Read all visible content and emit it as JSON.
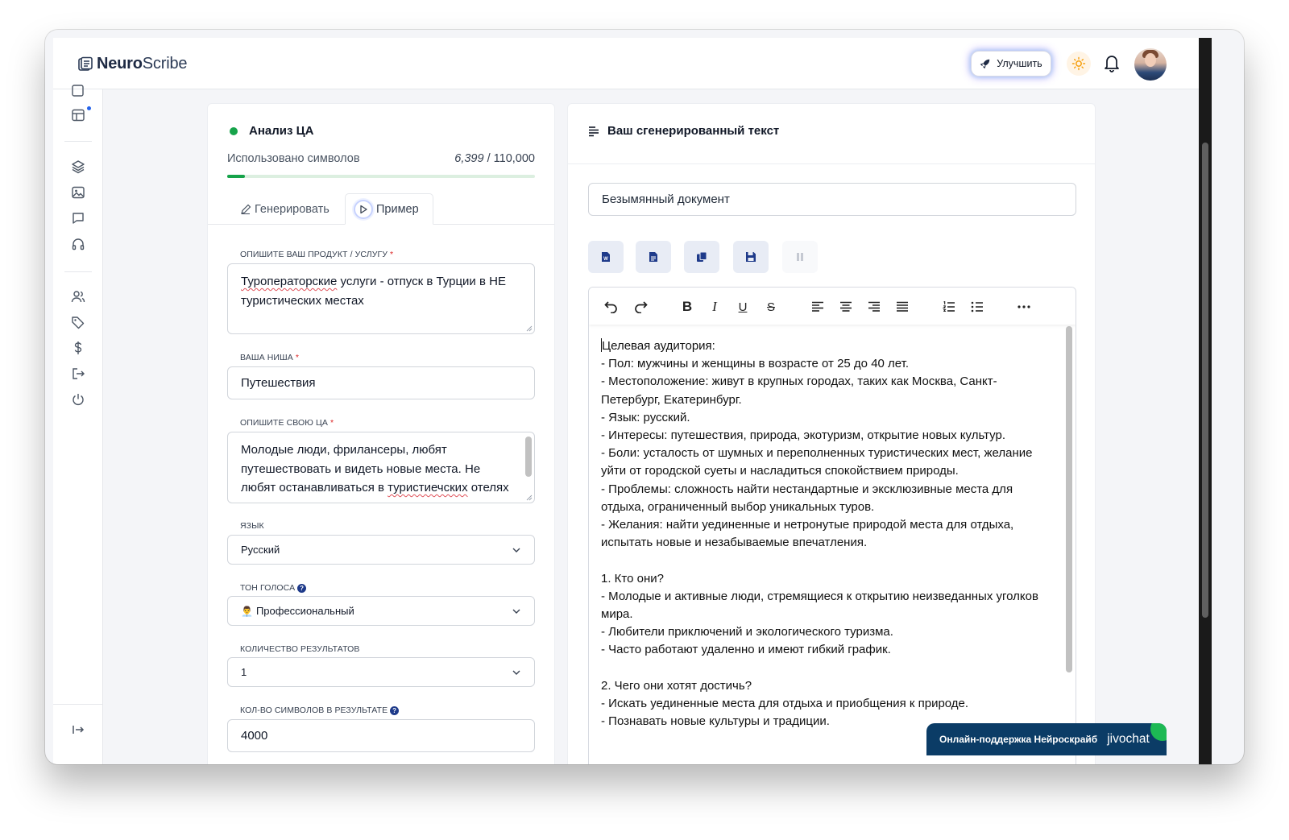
{
  "app": {
    "brand_bold": "Neuro",
    "brand_rest": "Scribe"
  },
  "header": {
    "upgrade_label": "Улучшить"
  },
  "tool": {
    "title": "Анализ ЦА",
    "usage_label": "Использовано символов",
    "usage_used": "6,399",
    "usage_total": "/ 110,000",
    "usage_fraction": 0.058
  },
  "tabs": [
    {
      "label": "Генерировать"
    },
    {
      "label": "Пример"
    }
  ],
  "form": {
    "product": {
      "label": "Опишите ваш продукт / услугу",
      "value_underlined": "Туроператорские",
      "value_rest": " услуги - отпуск в Турции в НЕ туристических местах"
    },
    "niche": {
      "label": "Ваша ниша",
      "value": "Путешествия"
    },
    "audience": {
      "label": "Опишите свою ЦА",
      "value_start": "Молодые люди, фрилансеры, любят путешествовать и видеть новые места. Не любят останавливаться в ",
      "value_underlined": "туристиечских",
      "value_end": " отелях"
    },
    "language": {
      "label": "Язык",
      "value": "Русский"
    },
    "tone": {
      "label": "Тон голоса",
      "emoji": "👨‍💼",
      "value": "Профессиональный"
    },
    "results_count": {
      "label": "Количество результатов",
      "value": "1"
    },
    "result_length": {
      "label": "Кол-во символов в результате",
      "value": "4000"
    }
  },
  "output": {
    "title": "Ваш сгенерированный текст",
    "doc_name": "Безымянный документ",
    "lines": [
      "Целевая аудитория:",
      "- Пол: мужчины и женщины в возрасте от 25 до 40 лет.",
      "- Местоположение: живут в крупных городах, таких как Москва, Санкт-Петербург, Екатеринбург.",
      "- Язык: русский.",
      "- Интересы: путешествия, природа, экотуризм, открытие новых культур.",
      "- Боли: усталость от шумных и переполненных туристических мест, желание уйти от городской суеты и насладиться спокойствием природы.",
      "- Проблемы: сложность найти нестандартные и эксклюзивные места для отдыха, ограниченный выбор уникальных туров.",
      "- Желания: найти уединенные и нетронутые природой места для отдыха, испытать новые и незабываемые впечатления.",
      "",
      "1. Кто они?",
      "- Молодые и активные люди, стремящиеся к открытию неизведанных уголков мира.",
      "- Любители приключений и экологического туризма.",
      "- Часто работают удаленно и имеют гибкий график.",
      "",
      "2. Чего они хотят достичь?",
      "- Искать уединенные места для отдыха и приобщения к природе.",
      "- Познавать новые культуры и традиции."
    ]
  },
  "chat": {
    "label": "Онлайн-поддержка Нейроскрайб",
    "logo": "jivochat"
  }
}
